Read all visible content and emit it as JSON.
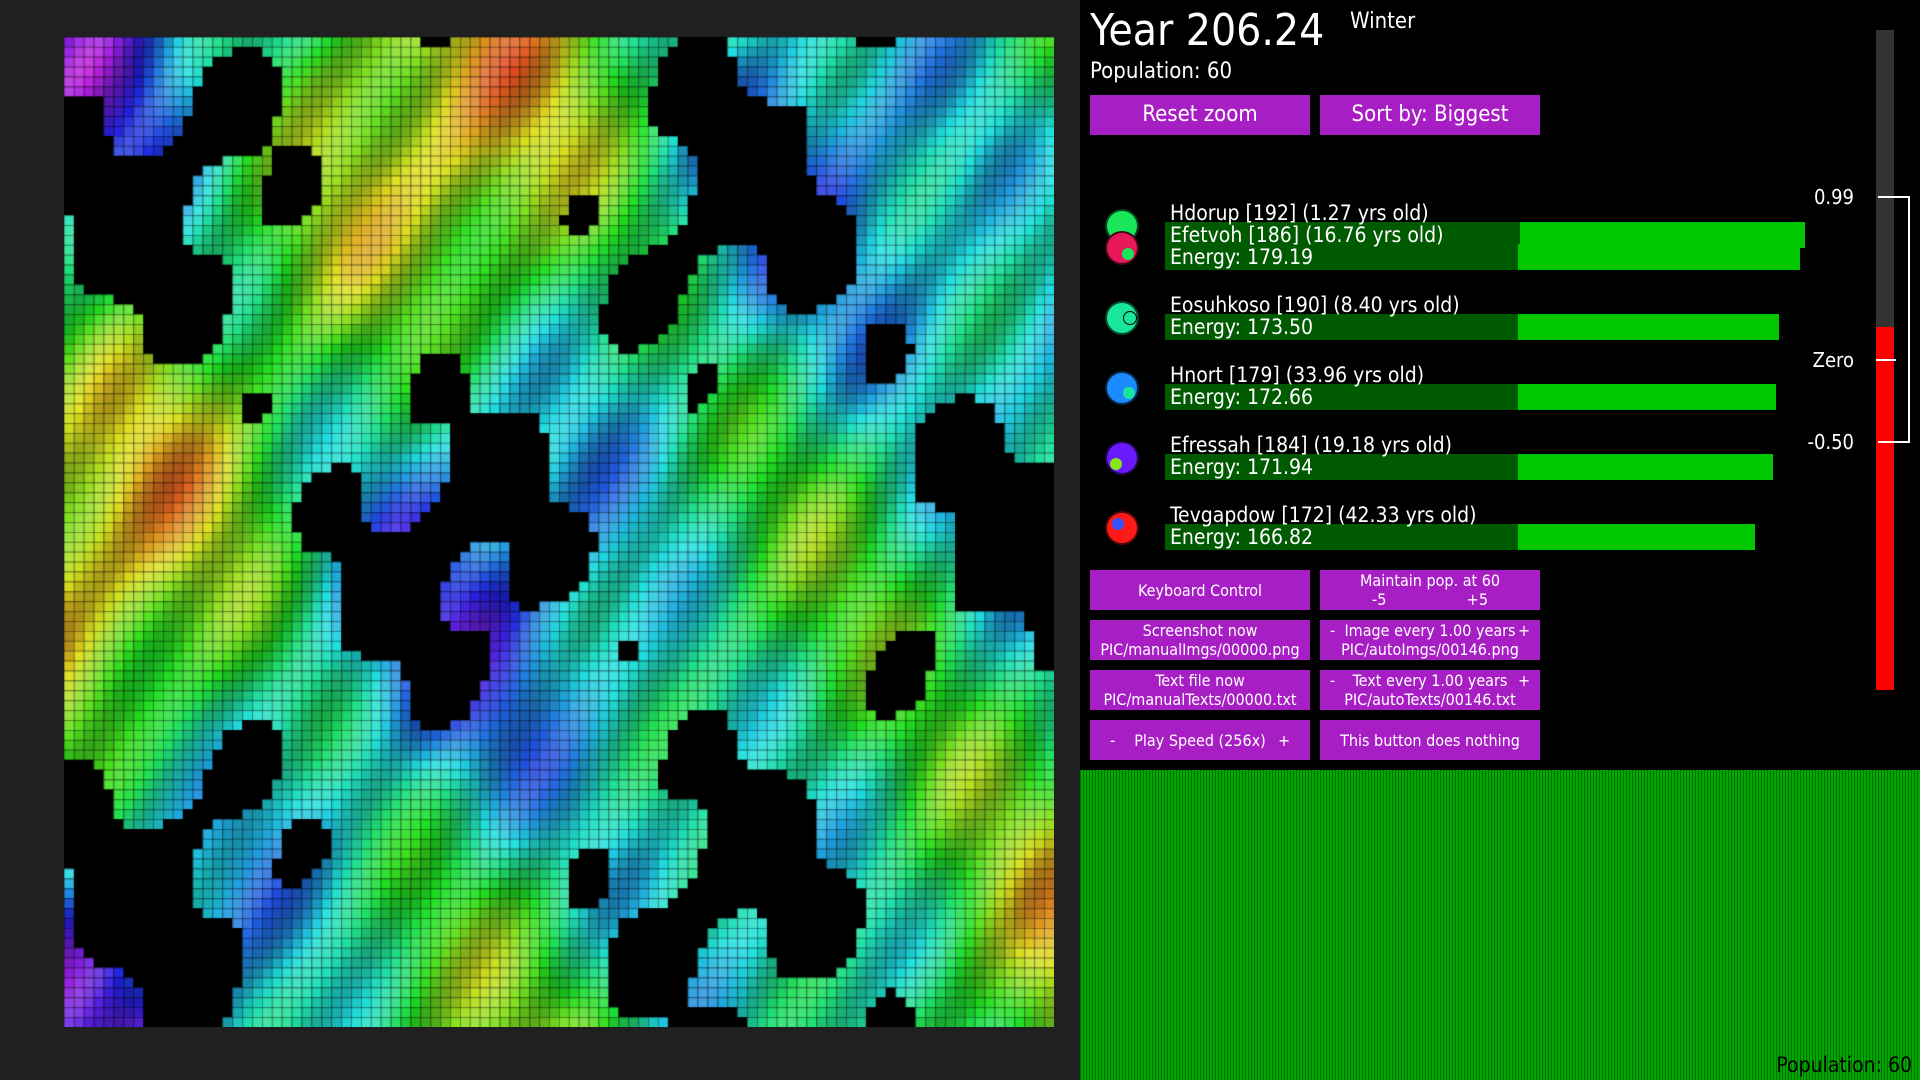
{
  "header": {
    "year": "Year 206.24",
    "season": "Winter",
    "population": "Population: 60"
  },
  "top_buttons": {
    "reset_zoom": "Reset zoom",
    "sort_by": "Sort by: Biggest"
  },
  "creatures": [
    {
      "name_line": "Hdorup [192] (1.27 yrs old)",
      "energy_line": "",
      "energy": 180.0,
      "color": "#19e65a",
      "accent": "#19e65a"
    },
    {
      "name_line": "Efetvoh [186] (16.76 yrs old)",
      "energy_line": "Energy: 179.19",
      "energy": 179.19,
      "color": "#e8195a",
      "accent": "#19e65a"
    },
    {
      "name_line": "Eosuhkoso [190] (8.40 yrs old)",
      "energy_line": "Energy: 173.50",
      "energy": 173.5,
      "color": "#19e69a",
      "accent": "#19e69a"
    },
    {
      "name_line": "Hnort [179] (33.96 yrs old)",
      "energy_line": "Energy: 172.66",
      "energy": 172.66,
      "color": "#1a8cff",
      "accent": "#19e69a"
    },
    {
      "name_line": "Efressah [184] (19.18 yrs old)",
      "energy_line": "Energy: 171.94",
      "energy": 171.94,
      "color": "#6a1aff",
      "accent": "#88e619"
    },
    {
      "name_line": "Tevgapdow [172] (42.33 yrs old)",
      "energy_line": "Energy: 166.82",
      "energy": 166.82,
      "color": "#ff1a1a",
      "accent": "#3355ff"
    }
  ],
  "controls": {
    "keyboard": "Keyboard Control",
    "maintain_line1": "Maintain pop. at 60",
    "maintain_minus": "-5",
    "maintain_plus": "+5",
    "screenshot_line1": "Screenshot now",
    "screenshot_line2": "PIC/manualImgs/00000.png",
    "image_every_minus": "-",
    "image_every_line1": "Image every 1.00 years",
    "image_every_plus": "+",
    "image_every_line2": "PIC/autoImgs/00146.png",
    "text_file_line1": "Text file now",
    "text_file_line2": "PIC/manualTexts/00000.txt",
    "text_every_minus": "-",
    "text_every_line1": "Text every 1.00 years",
    "text_every_plus": "+",
    "text_every_line2": "PIC/autoTexts/00146.txt",
    "play_minus": "-",
    "play_speed": "Play Speed (256x)",
    "play_plus": "+",
    "nothing": "This button does nothing"
  },
  "scale": {
    "top_label": "0.99",
    "zero_label": "Zero",
    "bottom_label": "-0.50",
    "value": 0.5,
    "track_color": "#333333",
    "fill_color": "#ff0000"
  },
  "histogram": {
    "population": "Population: 60",
    "color": "#00a800"
  },
  "colors": {
    "button": "#a71fc4",
    "energy_bar_dark": "#005b00",
    "energy_bar_light": "#00c800"
  }
}
